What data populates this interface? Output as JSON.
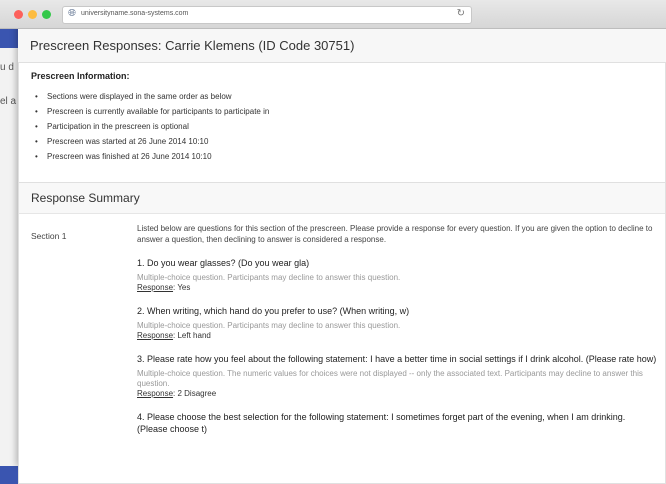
{
  "browser": {
    "url": "universityname.sona-systems.com"
  },
  "background": {
    "left_text_1": "u d",
    "left_text_2": "el a"
  },
  "page": {
    "title": "Prescreen Responses: Carrie Klemens (ID Code 30751)"
  },
  "info": {
    "heading": "Prescreen Information:",
    "items": [
      "Sections were displayed in the same order as below",
      "Prescreen is currently available for participants to participate in",
      "Participation in the prescreen is optional",
      "Prescreen was started at 26 June 2014 10:10",
      "Prescreen was finished at 26 June 2014 10:10"
    ]
  },
  "summary": {
    "heading": "Response Summary",
    "section_label": "Section 1",
    "intro": "Listed below are questions for this section of the prescreen. Please provide a response for every question. If you are given the option to decline to answer a question, then declining to answer is considered a response.",
    "response_label": "Response",
    "questions": [
      {
        "text": "1. Do you wear glasses? (Do you wear gla)",
        "note": "Multiple-choice question. Participants may decline to answer this question.",
        "response": ": Yes"
      },
      {
        "text": "2. When writing, which hand do you prefer to use? (When writing, w)",
        "note": "Multiple-choice question. Participants may decline to answer this question.",
        "response": ": Left hand"
      },
      {
        "text": "3. Please rate how you feel about the following statement: I have a better time in social settings if I drink alcohol. (Please rate how)",
        "note": "Multiple-choice question. The numeric values for choices were not displayed -- only the associated text. Participants may decline to answer this question.",
        "response": ": 2 Disagree"
      },
      {
        "text": "4. Please choose the best selection for the following statement: I sometimes forget part of the evening, when I am drinking. (Please choose t)",
        "note": "",
        "response": ""
      }
    ]
  }
}
